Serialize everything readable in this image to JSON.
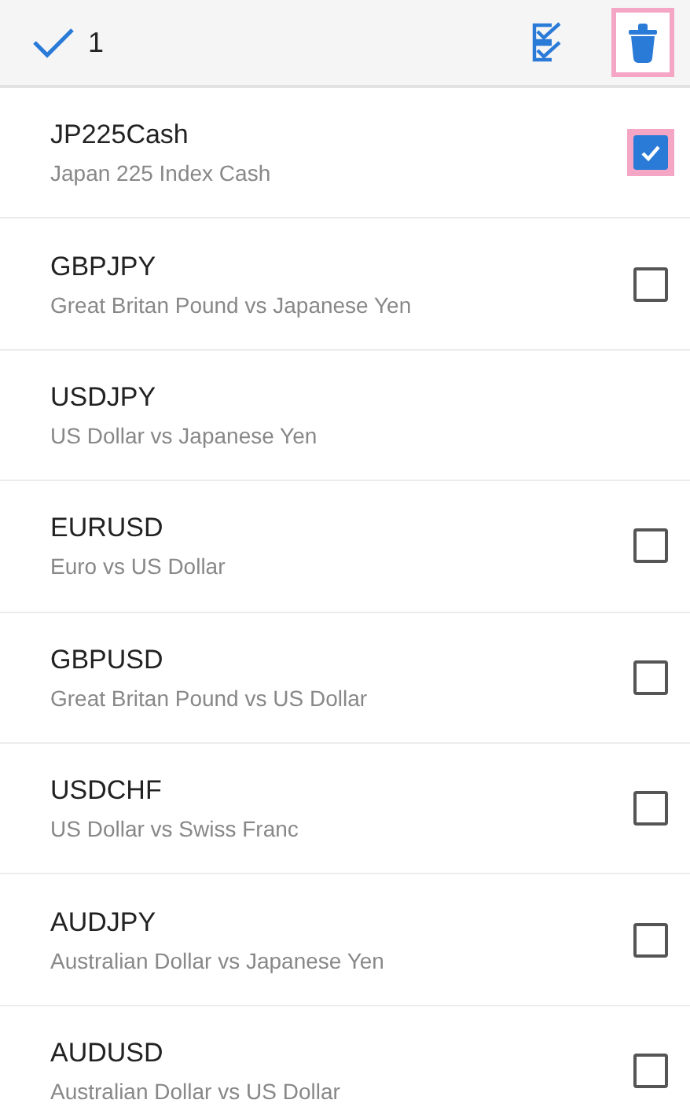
{
  "toolbar": {
    "selected_count": "1",
    "select_all_highlighted": false,
    "delete_highlighted": true
  },
  "symbols": [
    {
      "kind": "checkbox",
      "name": "JP225Cash",
      "description": "Japan 225 Index Cash",
      "checked": true,
      "highlighted": true
    },
    {
      "kind": "checkbox",
      "name": "GBPJPY",
      "description": "Great Britan Pound vs Japanese Yen",
      "checked": false,
      "highlighted": false
    },
    {
      "kind": "plain",
      "name": "USDJPY",
      "description": "US Dollar vs Japanese Yen"
    },
    {
      "kind": "checkbox",
      "name": "EURUSD",
      "description": "Euro vs US Dollar",
      "checked": false,
      "highlighted": false
    },
    {
      "kind": "checkbox",
      "name": "GBPUSD",
      "description": "Great Britan Pound vs US Dollar",
      "checked": false,
      "highlighted": false
    },
    {
      "kind": "checkbox",
      "name": "USDCHF",
      "description": "US Dollar vs Swiss Franc",
      "checked": false,
      "highlighted": false
    },
    {
      "kind": "checkbox",
      "name": "AUDJPY",
      "description": "Australian Dollar vs Japanese Yen",
      "checked": false,
      "highlighted": false
    },
    {
      "kind": "checkbox",
      "name": "AUDUSD",
      "description": "Australian Dollar vs US Dollar",
      "checked": false,
      "highlighted": false
    }
  ]
}
